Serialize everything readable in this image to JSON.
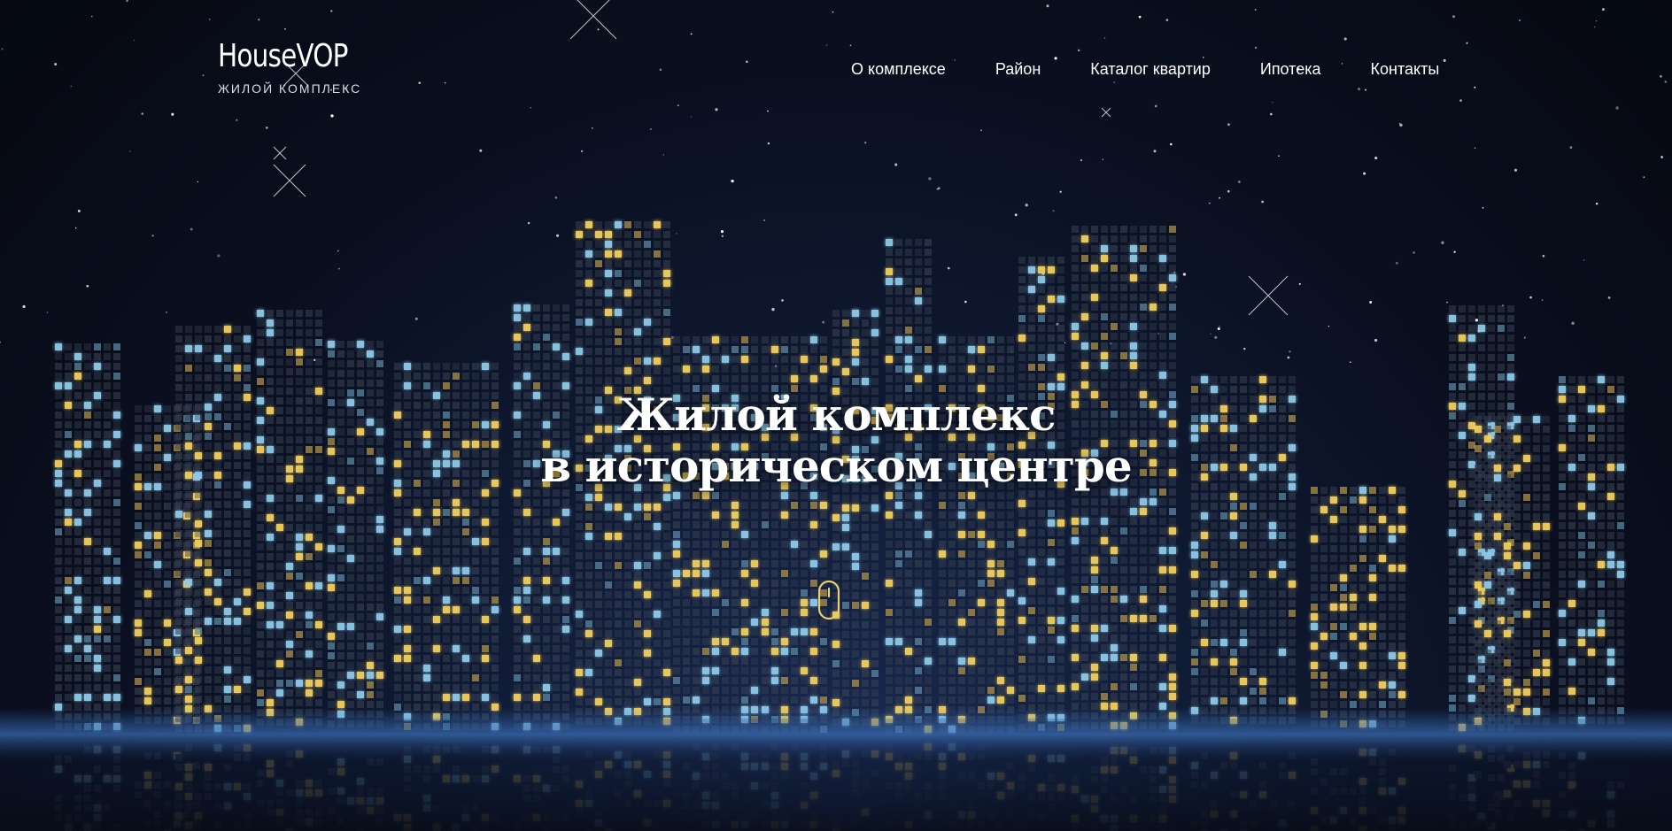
{
  "brand": {
    "name": "HouseVOP",
    "tagline": "ЖИЛОЙ КОМПЛЕКС"
  },
  "nav": {
    "items": [
      {
        "label": "О комплексе"
      },
      {
        "label": "Район"
      },
      {
        "label": "Каталог квартир"
      },
      {
        "label": "Ипотека"
      },
      {
        "label": "Контакты"
      }
    ]
  },
  "hero": {
    "title_line1": "Жилой комплекс",
    "title_line2": "в историческом центре",
    "scroll_icon": "mouse-icon"
  },
  "colors": {
    "background": "#0a0f1f",
    "window_yellow": "#f2d060",
    "window_blue": "#8fcbe8",
    "window_dim": "#3a4355",
    "horizon_glow": "#3d7fd6",
    "text": "#ffffff",
    "scroll_icon": "#e8cf72"
  }
}
